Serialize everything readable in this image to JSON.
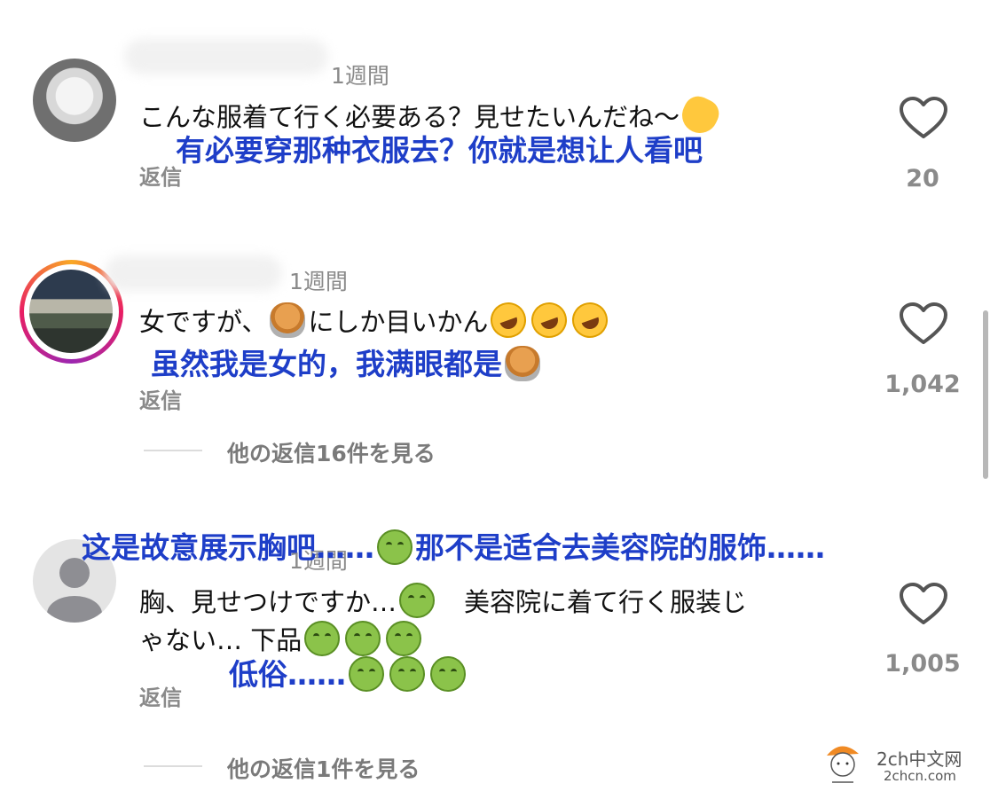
{
  "comments": [
    {
      "time": "1週間",
      "text_parts": [
        "こんな服着て行く必要ある？見せたいんだね〜"
      ],
      "trailing_emoji": "clapping-hands",
      "translation": "有必要穿那种衣服去？你就是想让人看吧",
      "reply": "返信",
      "likes": "20"
    },
    {
      "time": "1週間",
      "text_before": "女ですが、",
      "text_after": "にしか目いかん",
      "translation": "虽然我是女的，我满眼都是",
      "reply": "返信",
      "likes": "1,042",
      "more_replies": "他の返信16件を見る"
    },
    {
      "time": "1週間",
      "translation_top_1": "这是故意展示胸吧……",
      "translation_top_2": "那不是适合去美容院的服饰……",
      "line1_a": "胸、見せつけですか…",
      "line1_b": "美容院に着て行く服装じ",
      "line2": "ゃない… 下品",
      "translation_bottom": "低俗……",
      "reply": "返信",
      "likes": "1,005",
      "more_replies": "他の返信1件を見る"
    }
  ],
  "watermark": {
    "name": "2ch中文网",
    "url": "2chcn.com"
  },
  "colors": {
    "translation": "#1e3ec8",
    "secondary_text": "#8a8a8a"
  }
}
